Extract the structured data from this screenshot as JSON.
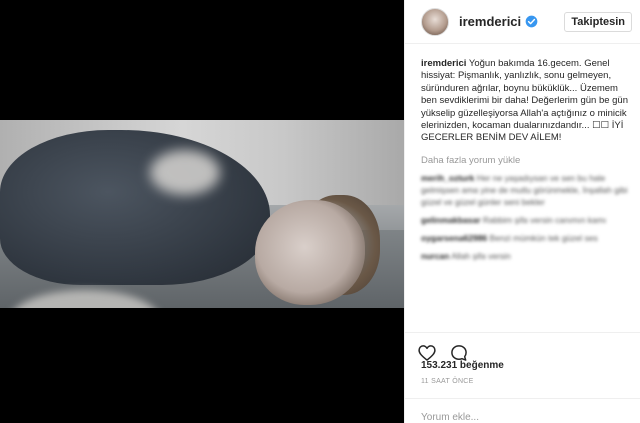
{
  "post": {
    "username": "iremderici",
    "follow_label": "Takiptesin",
    "caption_user": "iremderici",
    "caption_text": "Yoğun bakımda 16.gecem. Genel hissiyat: Pişmanlık, yanlızlık, sonu gelmeyen, süründuren ağrılar, boynu büküklük... Üzemem ben sevdiklerimi bir daha! Değerlerim gün be gün yükselip güzelleşiyorsa Allah'a açtığınız o minicik elerinizden, kocaman dualarınızdandır... ☐☐ İYİ GECERLER BENİM DEV AİLEM!",
    "load_more": "Daha fazla yorum yükle",
    "comments": [
      {
        "user": "merih_ozturk",
        "text": "Her ne yaşadıysan ve sen bu hale gelmişsen ama yine de mutlu görünmekle, İnşallah gibi güzel ve güzel günler seni bekler"
      },
      {
        "user": "gelinmakbasar",
        "text": "Rabbim şifa versin canımın kamı"
      },
      {
        "user": "oygarsena62986",
        "text": "Benzi mümkün tek güzel ses"
      },
      {
        "user": "nurcan",
        "text": "Allah şifa versin"
      }
    ],
    "likes_text": "153.231 beğenme",
    "time_text": "11 SAAT ÖNCE",
    "comment_placeholder": "Yorum ekle..."
  },
  "icons": {
    "verified": "verified-badge-icon",
    "like": "heart-icon",
    "comment": "comment-bubble-icon"
  },
  "colors": {
    "verified": "#3897f0",
    "text": "#262626",
    "muted": "#999999",
    "border": "#efefef"
  }
}
